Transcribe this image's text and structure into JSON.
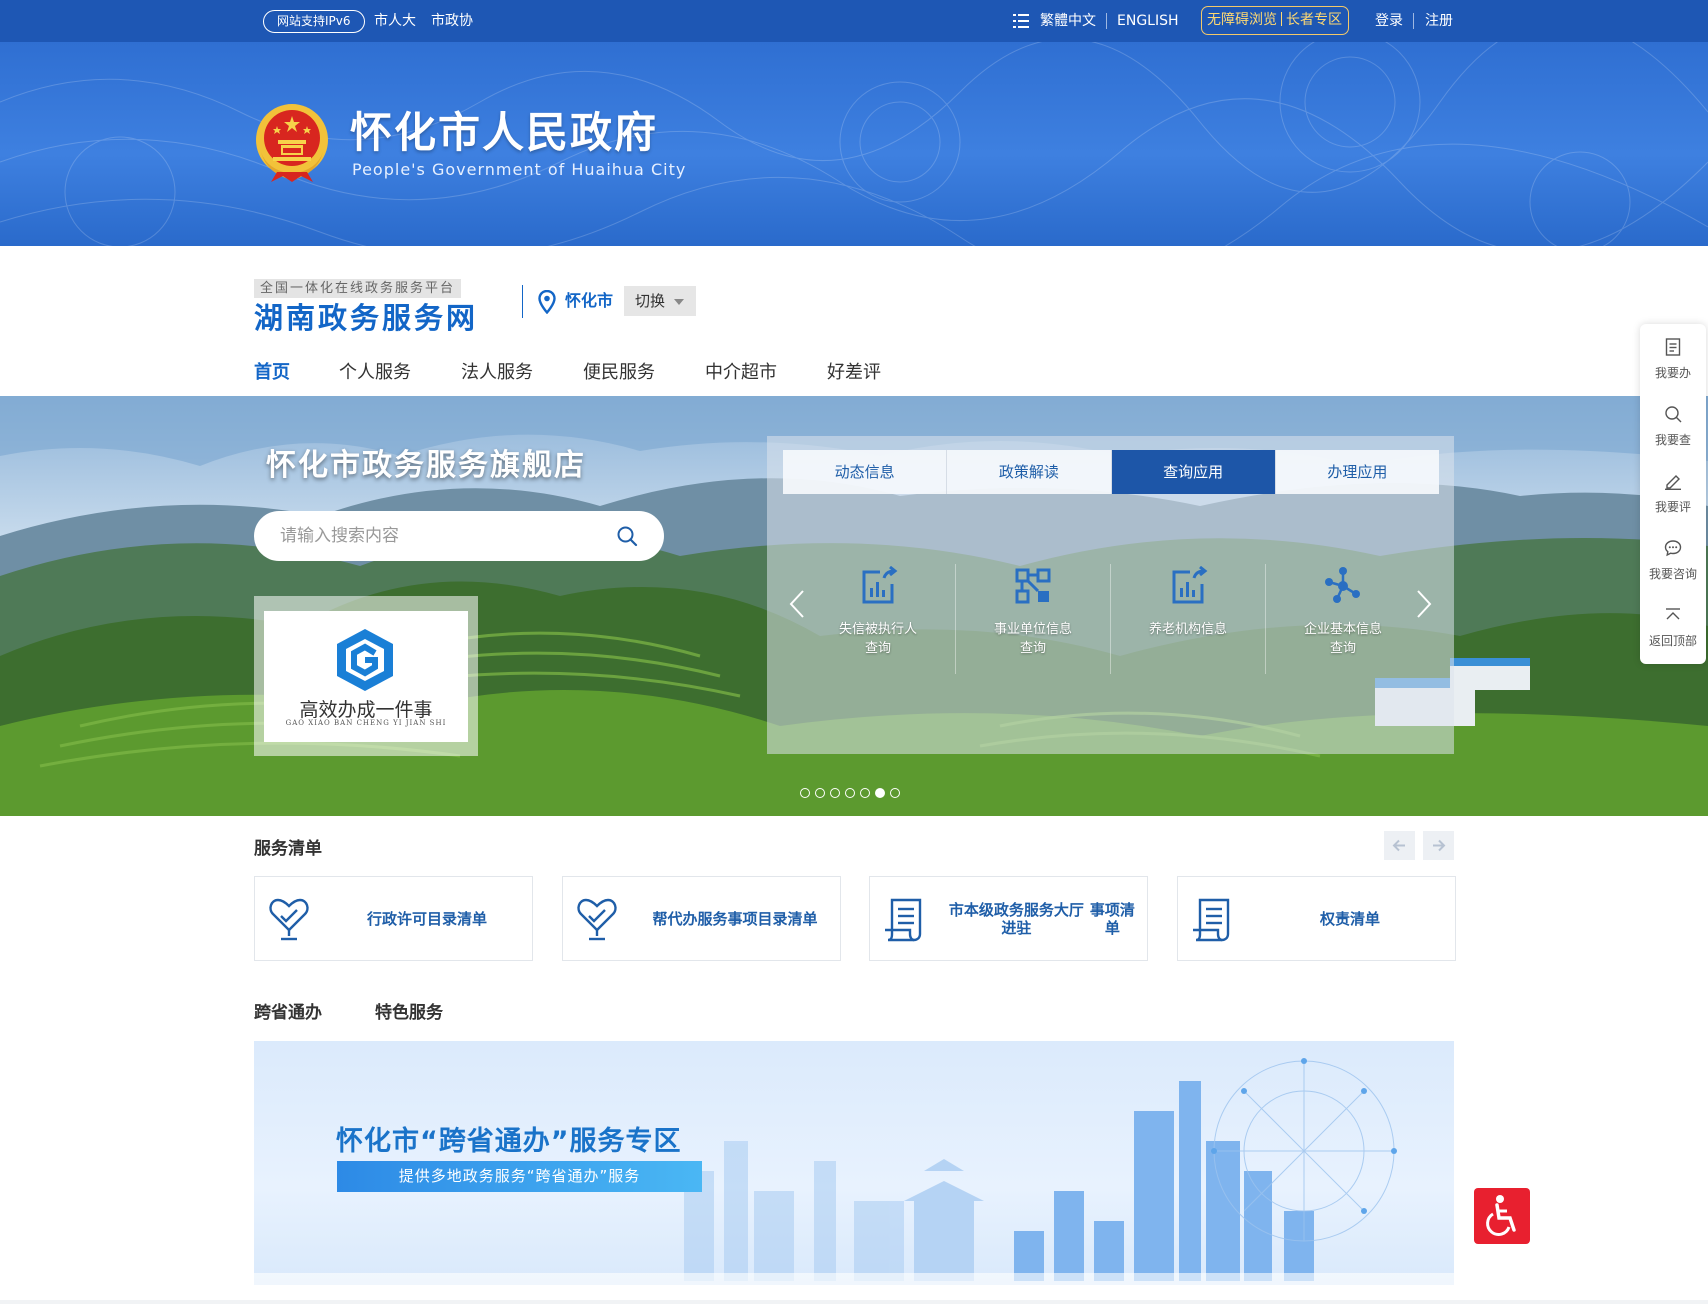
{
  "topbar": {
    "ipv6_badge": "网站支持IPv6",
    "links_left": [
      "市人大",
      "市政协"
    ],
    "traditional": "繁體中文",
    "english": "ENGLISH",
    "accessible_browse": "无障碍浏览",
    "elder_zone": "长者专区",
    "login": "登录",
    "register": "注册"
  },
  "header": {
    "title": "怀化市人民政府",
    "subtitle": "People's Government of Huaihua City"
  },
  "platform": {
    "tag": "全国一体化在线政务服务平台",
    "name": "湖南政务服务网",
    "city": "怀化市",
    "switch_label": "切换"
  },
  "nav": {
    "items": [
      {
        "label": "首页",
        "active": true
      },
      {
        "label": "个人服务"
      },
      {
        "label": "法人服务"
      },
      {
        "label": "便民服务"
      },
      {
        "label": "中介超市"
      },
      {
        "label": "好差评"
      }
    ]
  },
  "hero": {
    "title": "怀化市政务服务旗舰店",
    "search_placeholder": "请输入搜索内容",
    "promo_title": "高效办成一件事",
    "promo_pinyin": "GAO XIAO BAN CHENG YI JIAN SHI",
    "tabs": [
      {
        "label": "动态信息"
      },
      {
        "label": "政策解读"
      },
      {
        "label": "查询应用",
        "active": true
      },
      {
        "label": "办理应用"
      }
    ],
    "apps": [
      {
        "label_1": "失信被执行人",
        "label_2": "查询",
        "icon": "chart-export-icon"
      },
      {
        "label_1": "事业单位信息",
        "label_2": "查询",
        "icon": "org-structure-icon"
      },
      {
        "label_1": "养老机构信息",
        "label_2": "",
        "icon": "chart-export-icon"
      },
      {
        "label_1": "企业基本信息",
        "label_2": "查询",
        "icon": "network-nodes-icon"
      }
    ],
    "slides_total": 7,
    "slide_active": 6
  },
  "sidebar": {
    "items": [
      {
        "label": "我要办",
        "icon": "document-icon"
      },
      {
        "label": "我要查",
        "icon": "search-icon"
      },
      {
        "label": "我要评",
        "icon": "edit-icon"
      },
      {
        "label": "我要咨询",
        "icon": "chat-icon"
      },
      {
        "label": "返回顶部",
        "icon": "back-to-top-icon"
      }
    ]
  },
  "service_list": {
    "title": "服务清单",
    "cards": [
      {
        "label": "行政许可目录清单",
        "icon": "heart-hand-icon"
      },
      {
        "label": "帮代办服务事项目录清单",
        "icon": "heart-hand-icon"
      },
      {
        "label_1": "市本级政务服务大厅进驻",
        "label_2": "事项清单",
        "icon": "scroll-list-icon"
      },
      {
        "label": "权责清单",
        "icon": "scroll-list-icon"
      }
    ]
  },
  "section_tabs": {
    "tab1": "跨省通办",
    "tab2": "特色服务"
  },
  "kua_banner": {
    "title": "怀化市“跨省通办”服务专区",
    "subtitle": "提供多地政务服务“跨省通办”服务"
  },
  "colors": {
    "primary_blue": "#1366c7",
    "top_bar": "#1e57b4",
    "active_tab": "#1d56a8",
    "accessibility_red": "#e8202f",
    "elder_gold": "#ffd972"
  }
}
